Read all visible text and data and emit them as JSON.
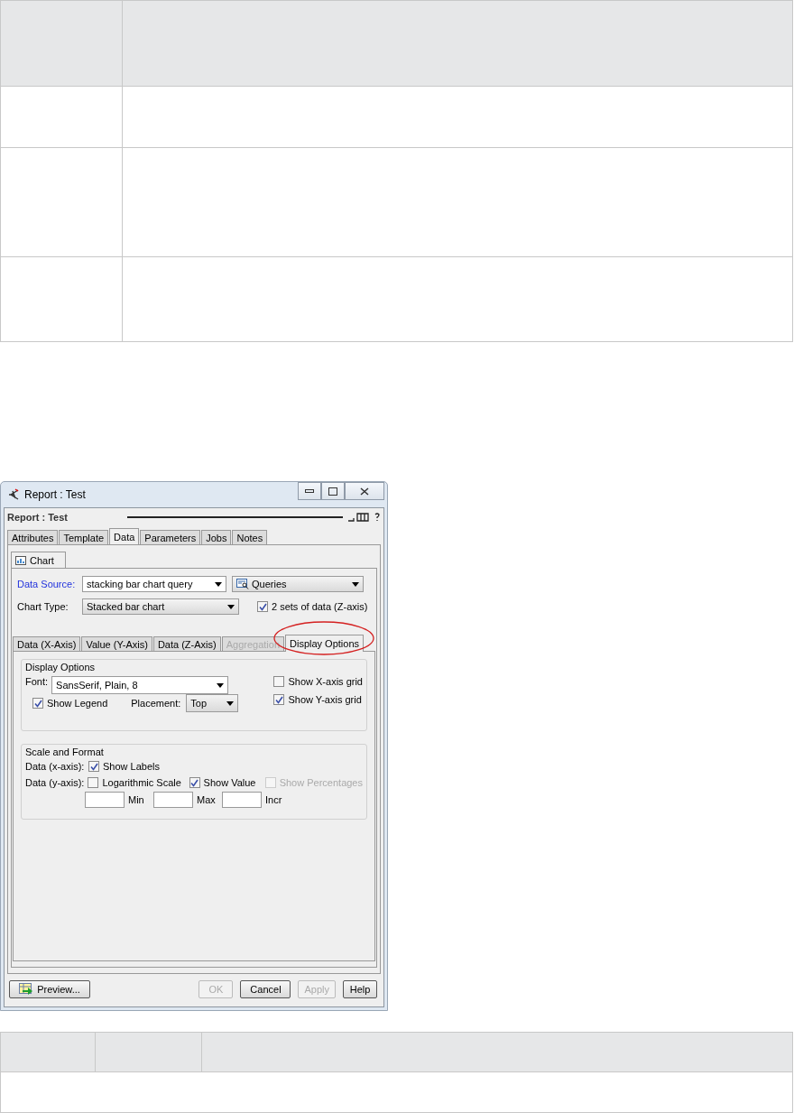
{
  "window": {
    "title": "Report : Test"
  },
  "panel": {
    "title": "Report : Test"
  },
  "tabs": [
    {
      "label": "Attributes",
      "selected": false
    },
    {
      "label": "Template",
      "selected": false
    },
    {
      "label": "Data",
      "selected": true
    },
    {
      "label": "Parameters",
      "selected": false
    },
    {
      "label": "Jobs",
      "selected": false
    },
    {
      "label": "Notes",
      "selected": false
    }
  ],
  "subtabs": [
    {
      "label": "Chart",
      "selected": true
    }
  ],
  "data_source": {
    "label": "Data Source:",
    "value": "stacking bar chart query",
    "queries": "Queries"
  },
  "chart_type": {
    "label": "Chart Type:",
    "value": "Stacked bar chart"
  },
  "z_axis": {
    "label": "2 sets of data (Z-axis)",
    "checked": true
  },
  "option_tabs": [
    {
      "label": "Data (X-Axis)",
      "selected": false,
      "disabled": false,
      "circled": false
    },
    {
      "label": "Value (Y-Axis)",
      "selected": false,
      "disabled": false,
      "circled": false
    },
    {
      "label": "Data (Z-Axis)",
      "selected": false,
      "disabled": false,
      "circled": false
    },
    {
      "label": "Aggregation",
      "selected": false,
      "disabled": true,
      "circled": false
    },
    {
      "label": "Display Options",
      "selected": true,
      "disabled": false,
      "circled": true
    }
  ],
  "display_options": {
    "title": "Display Options",
    "font_label": "Font:",
    "font_value": "SansSerif, Plain, 8",
    "show_legend": {
      "label": "Show Legend",
      "checked": true
    },
    "placement_label": "Placement:",
    "placement_value": "Top",
    "x_grid": {
      "label": "Show X-axis grid",
      "checked": false
    },
    "y_grid": {
      "label": "Show Y-axis grid",
      "checked": true
    }
  },
  "scale_format": {
    "title": "Scale and Format",
    "x_label": "Data (x-axis):",
    "y_label": "Data (y-axis):",
    "show_labels": {
      "label": "Show Labels",
      "checked": true,
      "disabled": false
    },
    "logarithmic": {
      "label": "Logarithmic Scale",
      "checked": false,
      "disabled": false
    },
    "show_value": {
      "label": "Show Value",
      "checked": true,
      "disabled": false
    },
    "show_percentages": {
      "label": "Show Percentages",
      "checked": false,
      "disabled": true
    },
    "fields": [
      {
        "label": "Min"
      },
      {
        "label": "Max"
      },
      {
        "label": "Incr"
      }
    ]
  },
  "preview": {
    "label": "Preview..."
  },
  "buttons": [
    {
      "label": "OK",
      "disabled": true
    },
    {
      "label": "Cancel",
      "disabled": false
    },
    {
      "label": "Apply",
      "disabled": true
    },
    {
      "label": "Help",
      "disabled": false
    }
  ]
}
